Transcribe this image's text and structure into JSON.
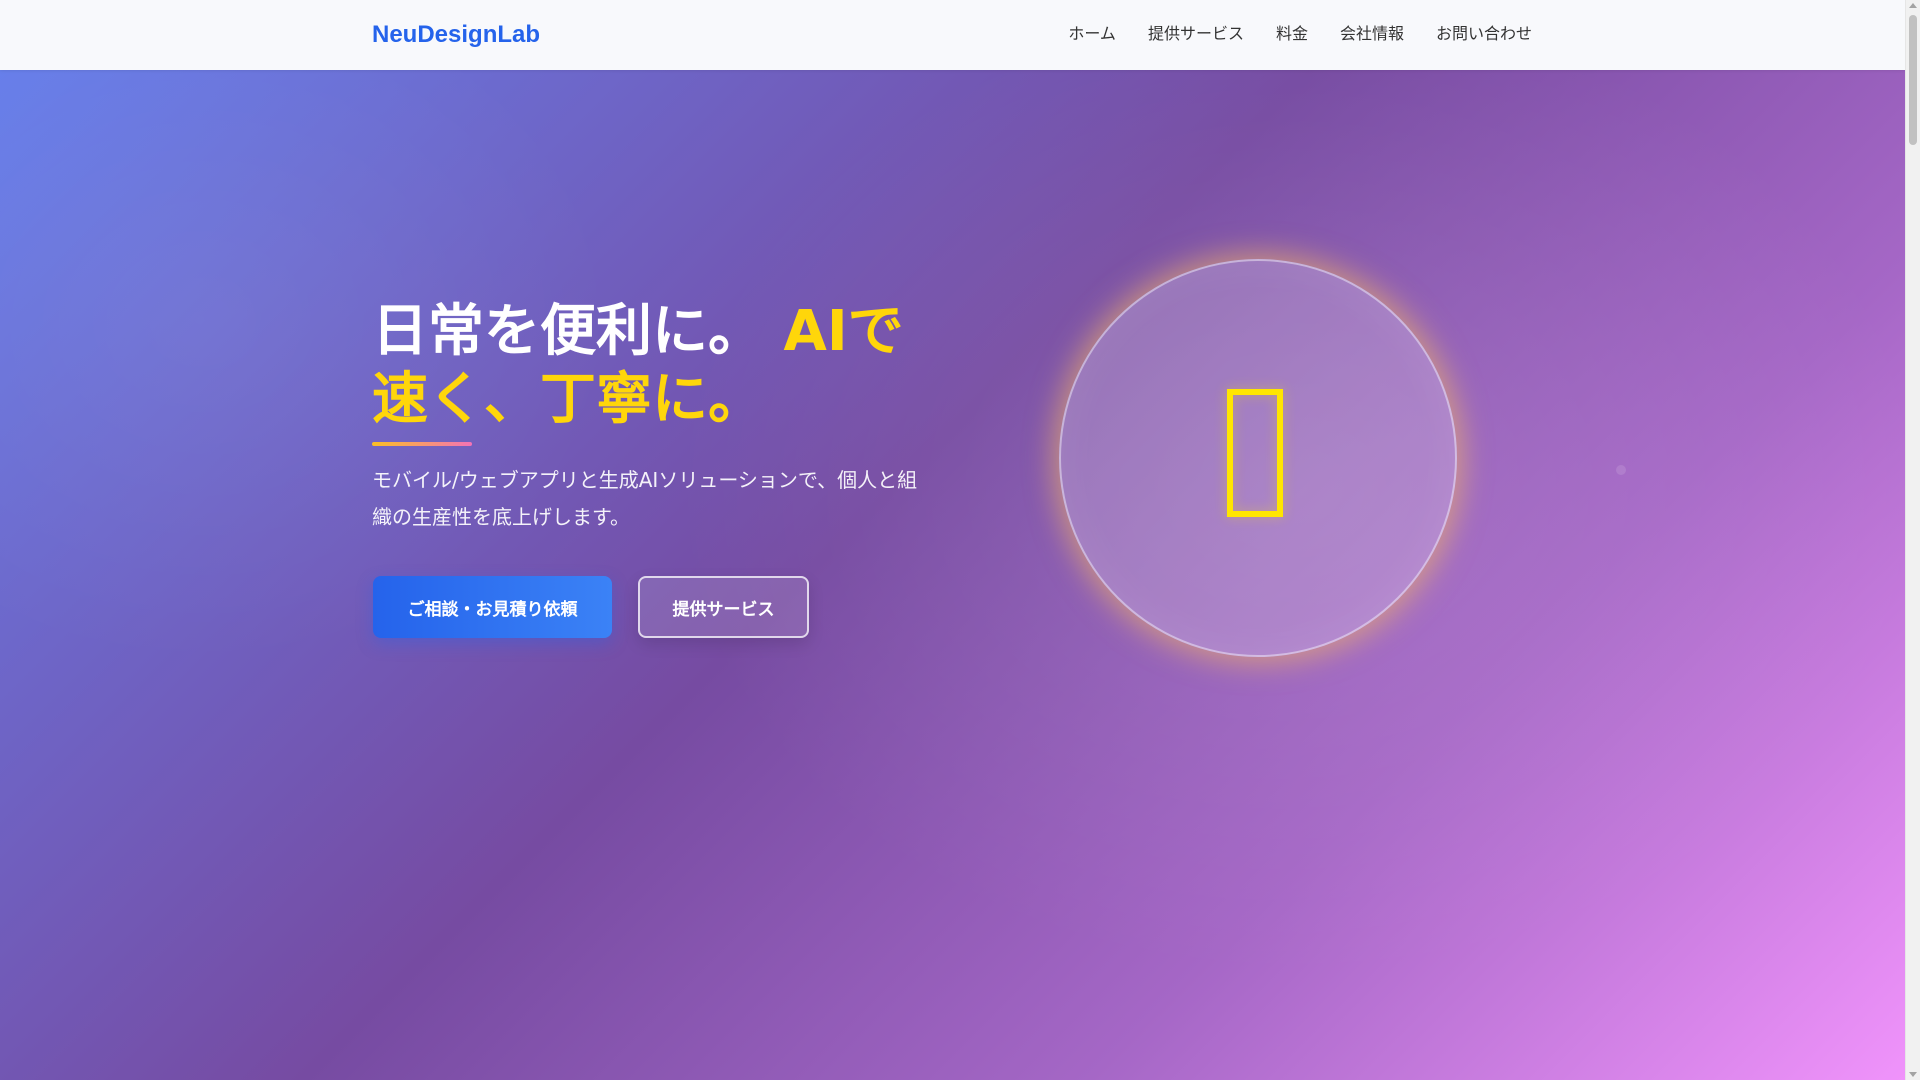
{
  "brand": {
    "logo_text": "NeuDesignLab",
    "color": "#2563eb"
  },
  "nav": {
    "items": [
      {
        "label": "ホーム"
      },
      {
        "label": "提供サービス"
      },
      {
        "label": "料金"
      },
      {
        "label": "会社情報"
      },
      {
        "label": "お問い合わせ"
      }
    ]
  },
  "hero": {
    "title_part1": "日常を便利に。",
    "title_part2": "AIで速く、丁寧に。",
    "description": "モバイル/ウェブアプリと生成AIソリューションで、個人と組織の生産性を底上げします。",
    "primary_button": "ご相談・お見積り依頼",
    "secondary_button": "提供サービス",
    "icon": "missing-glyph-icon",
    "accent_color": "#ffd60a",
    "gradient_start": "#667eea",
    "gradient_end": "#f093fb"
  }
}
